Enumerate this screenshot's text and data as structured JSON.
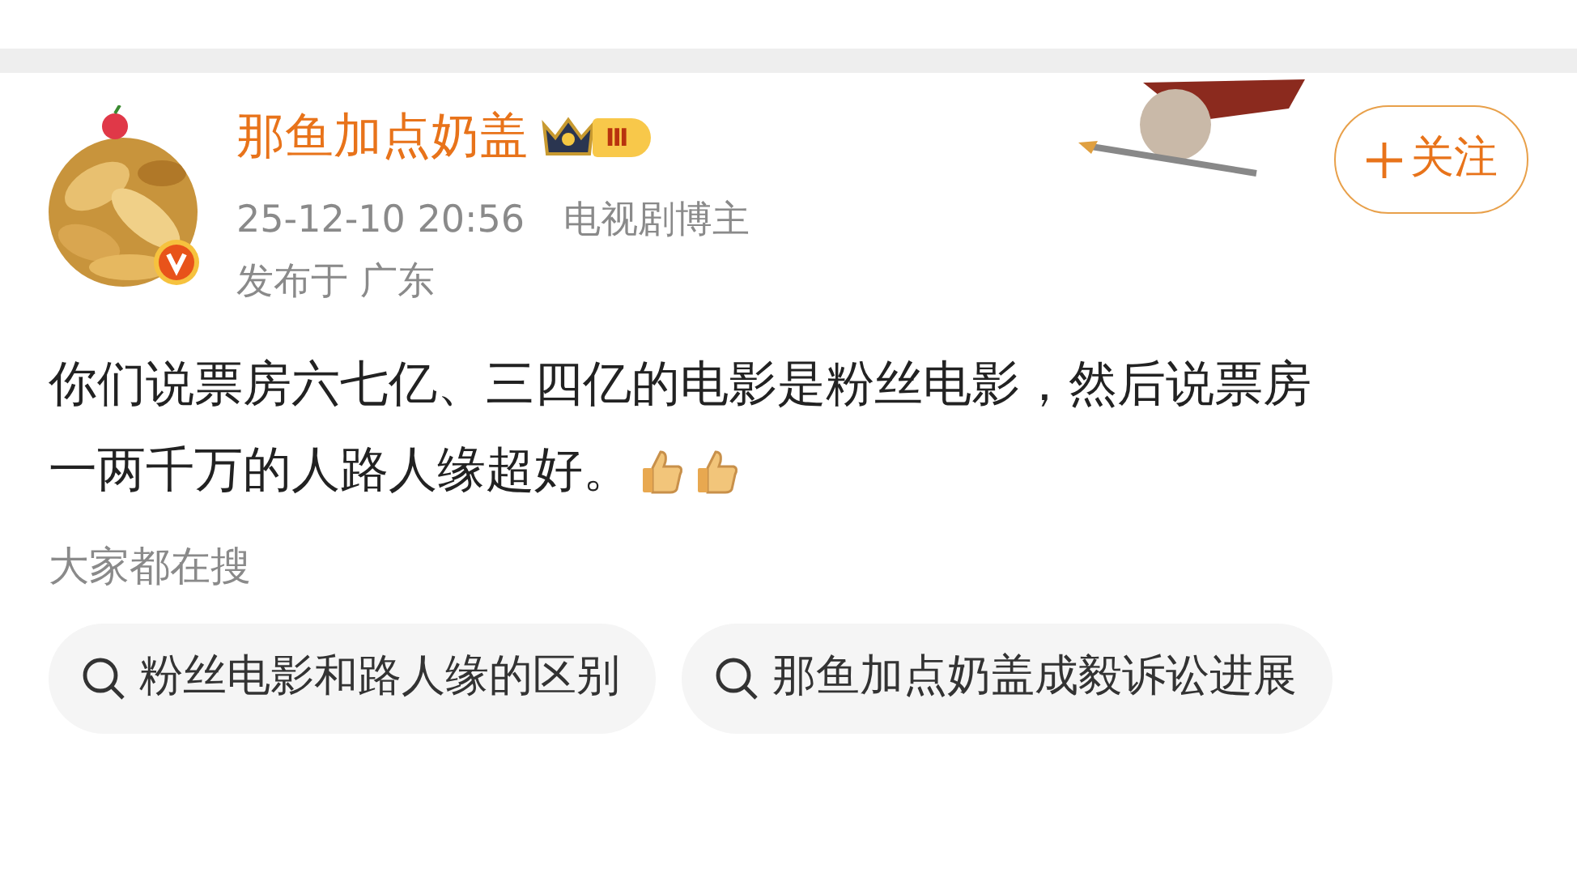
{
  "post": {
    "author": {
      "name": "那鱼加点奶盖",
      "verified": true,
      "level_badge": "Ⅲ"
    },
    "meta": "25-12-10 20:56",
    "tag": "电视剧博主",
    "location": "发布于 广东",
    "follow_button": "关注",
    "text_lines": [
      "你们说票房六七亿、三四亿的电影是粉丝电影，然后说票房",
      "一两千万的人路人缘超好。"
    ],
    "emojis": [
      {
        "kind": "thumbs_up"
      },
      {
        "kind": "thumbs_up"
      }
    ]
  },
  "trending": {
    "title": "大家都在搜",
    "items": [
      {
        "label": "粉丝电影和路人缘的区别"
      },
      {
        "label": "那鱼加点奶盖成毅诉讼进展"
      }
    ]
  }
}
